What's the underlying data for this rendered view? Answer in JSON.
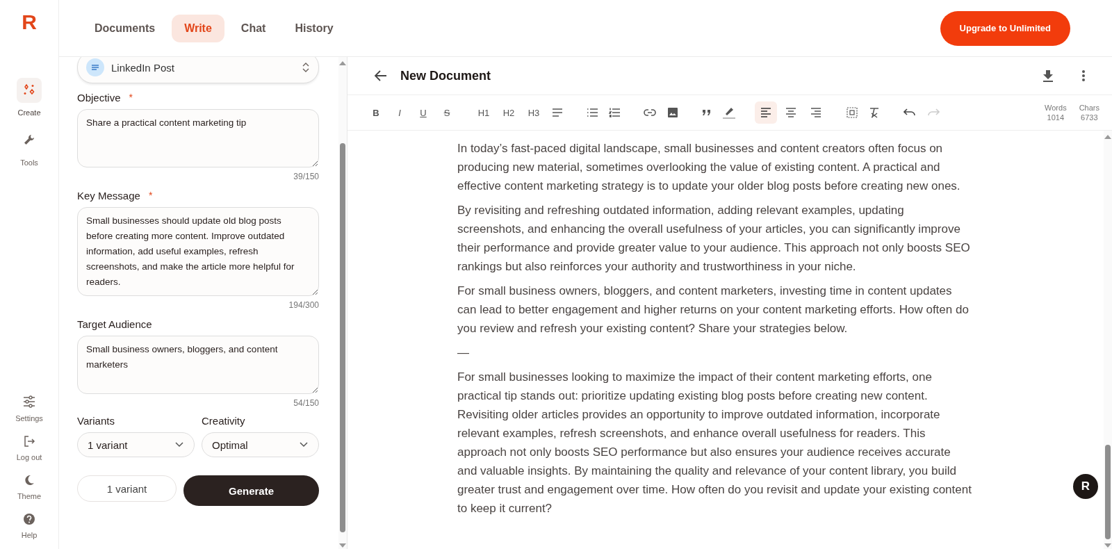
{
  "logo": "R",
  "rail": [
    {
      "label": "Create",
      "selected": true
    },
    {
      "label": "Tools",
      "selected": false
    }
  ],
  "rail_bottom": [
    {
      "label": "Settings"
    },
    {
      "label": "Log out"
    },
    {
      "label": "Theme"
    },
    {
      "label": "Help"
    }
  ],
  "tabs": [
    {
      "label": "Documents",
      "selected": false
    },
    {
      "label": "Write",
      "selected": true
    },
    {
      "label": "Chat",
      "selected": false
    },
    {
      "label": "History",
      "selected": false
    }
  ],
  "upgrade_button": "Upgrade to Unlimited",
  "form": {
    "post_type": "LinkedIn Post",
    "fields": [
      {
        "label": "Objective",
        "required_mark": "*",
        "value": "Share a practical content marketing tip",
        "counter": "39/150"
      },
      {
        "label": "Key Message",
        "required_mark": "*",
        "value": "Small businesses should update old blog posts before creating more content. Improve outdated information, add useful examples, refresh screenshots, and make the article more helpful for readers.",
        "counter": "194/300"
      },
      {
        "label": "Target Audience",
        "value": "Small business owners, bloggers, and content marketers",
        "counter": "54/150"
      }
    ],
    "variants": {
      "label": "Variants",
      "value": "1 variant"
    },
    "creativity": {
      "label": "Creativity",
      "value": "Optimal"
    },
    "variant_button": "1 variant",
    "generate_button": "Generate"
  },
  "document": {
    "title": "New Document",
    "format_buttons": [
      "B",
      "I",
      "U",
      "S"
    ],
    "heading_buttons": [
      "H1",
      "H2",
      "H3"
    ],
    "alignment": [
      {
        "selected": true
      },
      {
        "selected": false
      },
      {
        "selected": false
      }
    ],
    "redo_disabled": true,
    "stats": [
      {
        "label": "Words",
        "value": "1014"
      },
      {
        "label": "Chars",
        "value": "6733"
      }
    ],
    "paragraphs": [
      "In today’s fast-paced digital landscape, small businesses and content creators often focus on producing new material, sometimes overlooking the value of existing content. A practical and effective content marketing strategy is to update your older blog posts before creating new ones.",
      "By revisiting and refreshing outdated information, adding relevant examples, updating screenshots, and enhancing the overall usefulness of your articles, you can significantly improve their performance and provide greater value to your audience. This approach not only boosts SEO rankings but also reinforces your authority and trustworthiness in your niche.",
      "For small business owners, bloggers, and content marketers, investing time in content updates can lead to better engagement and higher returns on your content marketing efforts. How often do you review and refresh your existing content? Share your strategies below.",
      "—",
      "For small businesses looking to maximize the impact of their content marketing efforts, one practical tip stands out: prioritize updating existing blog posts before creating new content. Revisiting older articles provides an opportunity to improve outdated information, incorporate relevant examples, refresh screenshots, and enhance overall usefulness for readers. This approach not only boosts SEO performance but also ensures your audience receives accurate and valuable insights. By maintaining the quality and relevance of your content library, you build greater trust and engagement over time. How often do you revisit and update your existing content to keep it current?"
    ]
  },
  "assistant_button": "R"
}
